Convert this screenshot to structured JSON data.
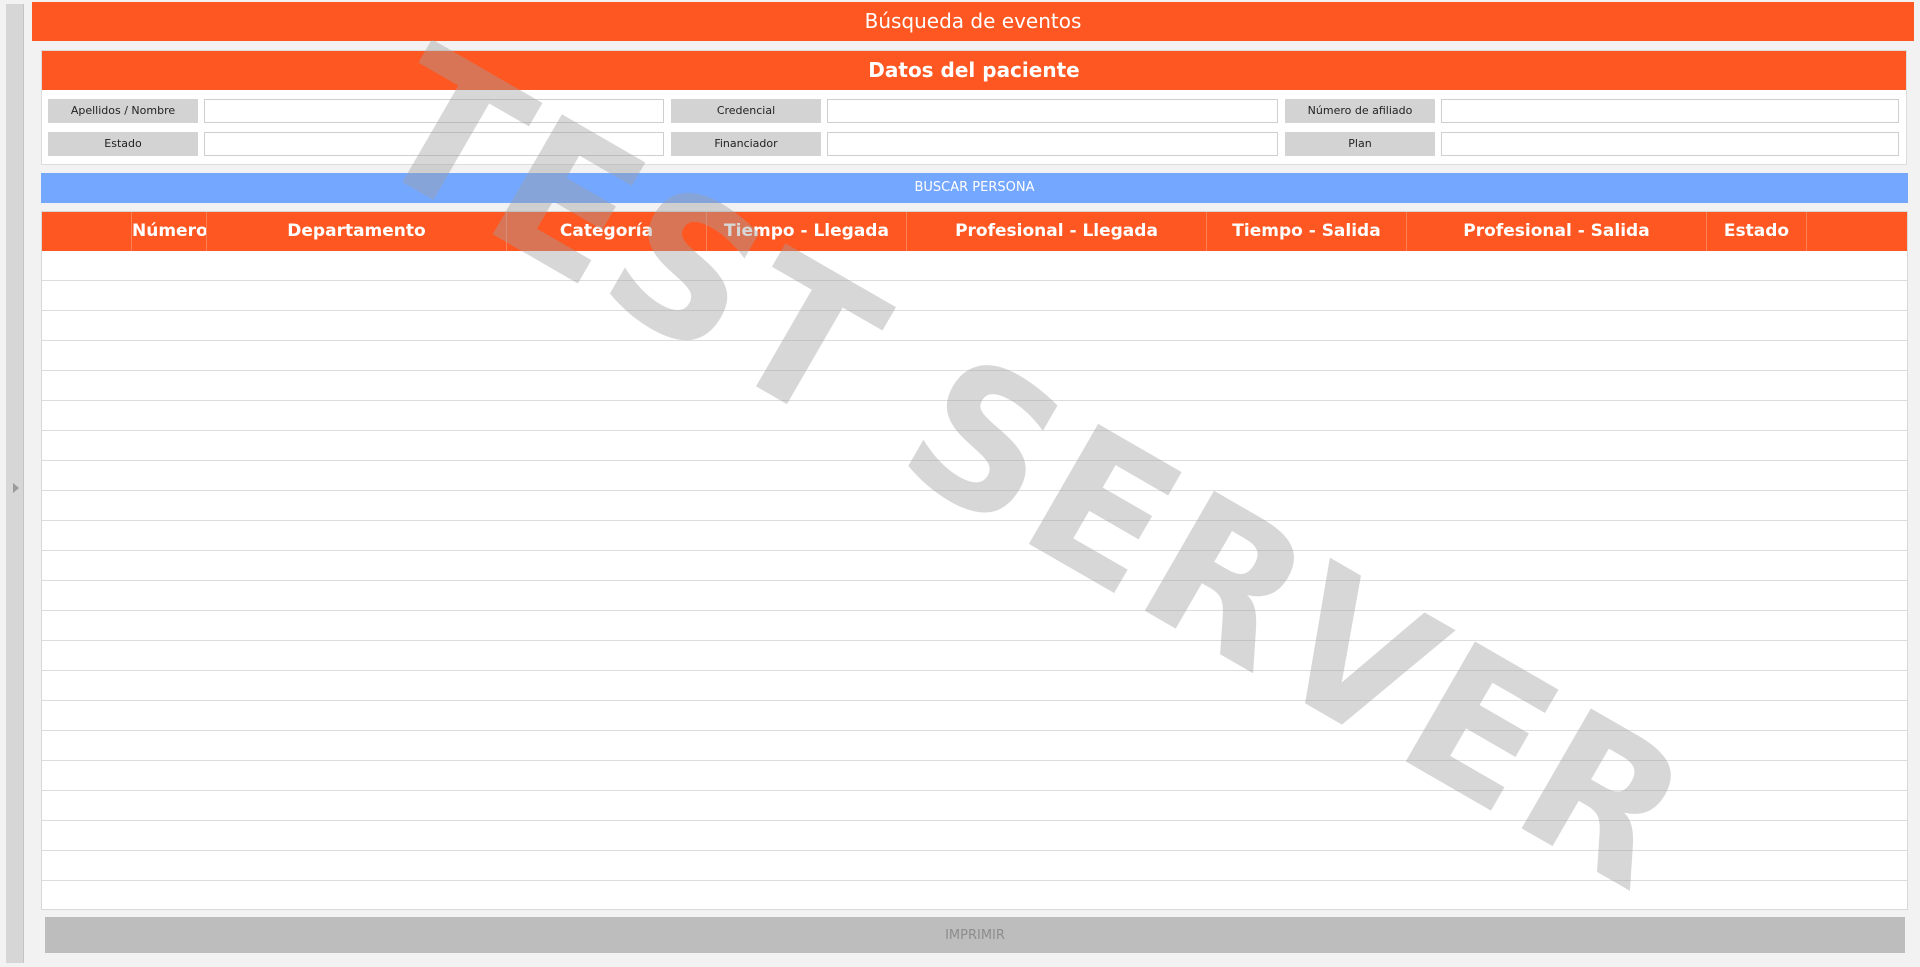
{
  "header": {
    "title": "Búsqueda de eventos"
  },
  "patient_panel": {
    "title": "Datos del paciente",
    "fields": [
      {
        "label": "Apellidos / Nombre",
        "value": ""
      },
      {
        "label": "Credencial",
        "value": ""
      },
      {
        "label": "Número de afiliado",
        "value": ""
      },
      {
        "label": "Estado",
        "value": ""
      },
      {
        "label": "Financiador",
        "value": ""
      },
      {
        "label": "Plan",
        "value": ""
      }
    ]
  },
  "search_button": {
    "label": "BUSCAR PERSONA"
  },
  "table": {
    "columns": [
      "",
      "Número",
      "Departamento",
      "Categoría",
      "Tiempo - Llegada",
      "Profesional - Llegada",
      "Tiempo - Salida",
      "Profesional - Salida",
      "Estado",
      ""
    ],
    "rows": []
  },
  "print_button": {
    "label": "IMPRIMIR"
  },
  "watermark": {
    "text": "TEST SERVER"
  },
  "colors": {
    "accent": "#ff5722",
    "search_button": "#74a7ff",
    "disabled_button": "#bdbdbd"
  },
  "icons": {
    "sidebar_toggle": "caret-right-icon"
  }
}
